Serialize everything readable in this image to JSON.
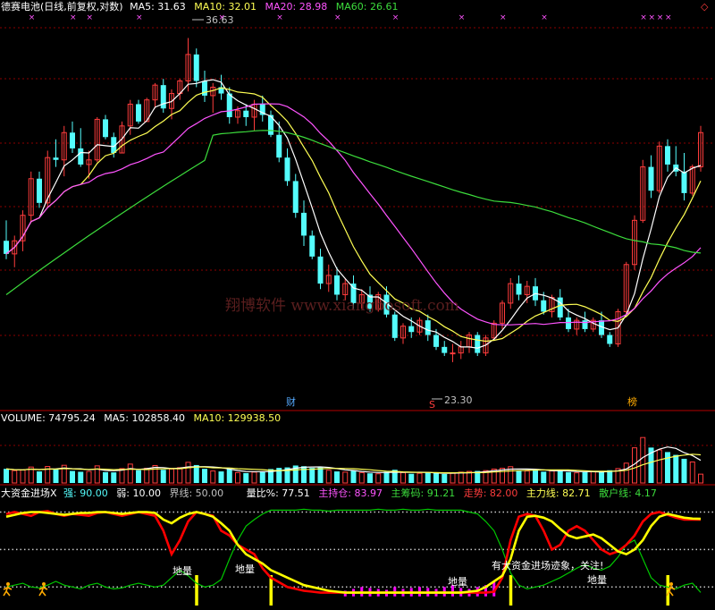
{
  "colors": {
    "up": "#ff3c3c",
    "down": "#54fcfc",
    "ma5": "#ffffff",
    "ma10": "#ffff54",
    "ma20": "#ff54ff",
    "ma60": "#3cdc3c",
    "grid": "#8c0000",
    "dots": "#c8c8c8",
    "red_line": "#ff0000",
    "yellow_line": "#ffff00",
    "green_line": "#00c800",
    "magenta_bar": "#ff00ff",
    "cyan_text": "#54fcfc",
    "white_text": "#ffffff",
    "gray_text": "#c0c0c0"
  },
  "header": {
    "title": "德赛电池(日线,前复权,对数)",
    "ma5": "MA5: 31.63",
    "ma10": "MA10: 32.01",
    "ma20": "MA20: 28.98",
    "ma60": "MA60: 26.61",
    "diamond": "◇"
  },
  "price_annotations": {
    "high": "36.63",
    "low": "23.30",
    "cai": "财",
    "s": "S",
    "bang": "榜",
    "watermark": "翔博软件 www.xiangbosoft.com"
  },
  "volume_header": {
    "volume": "VOLUME: 74795.24",
    "ma5": "MA5: 102858.40",
    "ma10": "MA10: 129938.50"
  },
  "indicator_header": {
    "name": "大资金进场X",
    "strong": "强: 90.00",
    "weak": "弱: 10.00",
    "boundary": "界线: 50.00",
    "volume_ratio": "量比%: 77.51",
    "main_hold": "主持仓: 83.97",
    "main_chip": "主筹码: 91.21",
    "trend": "走势: 82.00",
    "main_line": "主力线: 82.71",
    "retail_line": "散户线: 4.17"
  },
  "indicator_annotations": {
    "label1": "地量",
    "label2": "地量",
    "label3": "地量",
    "label4": "地量",
    "capital_text": "有大资金进场迹象，关注!"
  },
  "chart_data": [
    {
      "type": "candlestick",
      "title": "德赛电池(日线,前复权,对数)",
      "y_scale": "log",
      "ylim": [
        22.3,
        37.3
      ],
      "ohlc": [
        [
          27.6,
          28.4,
          26.9,
          27.1
        ],
        [
          27.1,
          27.8,
          26.6,
          27.6
        ],
        [
          27.6,
          28.8,
          27.2,
          28.6
        ],
        [
          28.6,
          30.4,
          28.3,
          30.1
        ],
        [
          30.1,
          30.4,
          28.9,
          29.1
        ],
        [
          29.1,
          31.3,
          28.9,
          31.0
        ],
        [
          31.0,
          31.8,
          30.6,
          30.9
        ],
        [
          30.9,
          32.4,
          30.2,
          32.1
        ],
        [
          32.1,
          32.6,
          31.2,
          31.4
        ],
        [
          31.4,
          32.3,
          30.6,
          30.7
        ],
        [
          30.7,
          31.3,
          30.1,
          30.9
        ],
        [
          30.9,
          32.8,
          30.8,
          32.7
        ],
        [
          32.7,
          32.9,
          31.8,
          31.9
        ],
        [
          31.9,
          32.1,
          31.0,
          31.2
        ],
        [
          31.2,
          32.6,
          31.2,
          32.4
        ],
        [
          32.4,
          33.6,
          32.0,
          33.4
        ],
        [
          33.4,
          33.6,
          32.5,
          32.6
        ],
        [
          32.6,
          33.7,
          32.6,
          33.6
        ],
        [
          33.6,
          34.4,
          33.2,
          34.3
        ],
        [
          34.3,
          34.6,
          33.0,
          33.2
        ],
        [
          33.2,
          34.1,
          32.7,
          33.9
        ],
        [
          33.9,
          34.6,
          33.6,
          34.5
        ],
        [
          34.5,
          36.63,
          34.0,
          35.8
        ],
        [
          35.8,
          36.1,
          34.2,
          34.5
        ],
        [
          34.5,
          35.0,
          33.5,
          33.8
        ],
        [
          33.8,
          34.4,
          33.0,
          34.2
        ],
        [
          34.2,
          34.8,
          33.6,
          33.9
        ],
        [
          33.9,
          34.2,
          32.5,
          32.8
        ],
        [
          32.8,
          33.3,
          32.5,
          33.1
        ],
        [
          33.1,
          33.4,
          32.4,
          32.8
        ],
        [
          32.8,
          33.6,
          32.2,
          33.4
        ],
        [
          33.4,
          33.8,
          32.6,
          32.9
        ],
        [
          32.9,
          33.1,
          31.9,
          32.0
        ],
        [
          32.0,
          32.6,
          30.8,
          31.0
        ],
        [
          31.0,
          31.4,
          29.8,
          30.0
        ],
        [
          30.0,
          30.3,
          28.5,
          28.7
        ],
        [
          28.7,
          29.2,
          27.4,
          27.8
        ],
        [
          27.8,
          28.0,
          26.9,
          27.0
        ],
        [
          27.0,
          27.3,
          25.8,
          26.0
        ],
        [
          26.0,
          26.7,
          25.7,
          26.3
        ],
        [
          26.3,
          26.6,
          25.4,
          25.6
        ],
        [
          25.6,
          26.2,
          25.4,
          26.0
        ],
        [
          26.0,
          26.3,
          25.1,
          25.3
        ],
        [
          25.3,
          25.8,
          25.1,
          25.6
        ],
        [
          25.6,
          25.9,
          25.0,
          25.1
        ],
        [
          25.1,
          25.7,
          25.0,
          25.6
        ],
        [
          25.6,
          25.9,
          24.8,
          24.9
        ],
        [
          24.9,
          25.0,
          24.0,
          24.1
        ],
        [
          24.1,
          24.6,
          23.9,
          24.5
        ],
        [
          24.5,
          24.8,
          24.1,
          24.3
        ],
        [
          24.3,
          24.8,
          24.2,
          24.7
        ],
        [
          24.7,
          24.9,
          24.0,
          24.2
        ],
        [
          24.2,
          24.4,
          23.7,
          23.8
        ],
        [
          23.8,
          24.0,
          23.5,
          23.6
        ],
        [
          23.6,
          23.9,
          23.3,
          23.6
        ],
        [
          23.6,
          24.0,
          23.4,
          23.8
        ],
        [
          23.8,
          24.3,
          23.6,
          24.2
        ],
        [
          24.2,
          24.3,
          23.5,
          23.6
        ],
        [
          23.6,
          24.2,
          23.5,
          24.1
        ],
        [
          24.1,
          24.7,
          24.0,
          24.6
        ],
        [
          24.6,
          25.4,
          24.4,
          25.3
        ],
        [
          25.3,
          26.2,
          25.1,
          26.0
        ],
        [
          26.0,
          26.3,
          25.4,
          25.6
        ],
        [
          25.6,
          26.1,
          25.3,
          25.9
        ],
        [
          25.9,
          26.2,
          25.2,
          25.4
        ],
        [
          25.4,
          25.7,
          24.9,
          25.0
        ],
        [
          25.0,
          25.6,
          24.8,
          25.5
        ],
        [
          25.5,
          25.8,
          24.7,
          24.8
        ],
        [
          24.8,
          25.1,
          24.3,
          24.4
        ],
        [
          24.4,
          24.8,
          24.2,
          24.7
        ],
        [
          24.7,
          25.0,
          24.3,
          24.4
        ],
        [
          24.4,
          24.8,
          24.3,
          24.7
        ],
        [
          24.7,
          25.0,
          24.1,
          24.2
        ],
        [
          24.2,
          24.3,
          23.8,
          23.9
        ],
        [
          23.9,
          25.1,
          23.8,
          25.0
        ],
        [
          25.0,
          26.8,
          24.9,
          26.7
        ],
        [
          26.7,
          28.6,
          26.5,
          28.4
        ],
        [
          28.4,
          30.9,
          28.3,
          30.6
        ],
        [
          30.6,
          31.1,
          29.3,
          29.6
        ],
        [
          29.6,
          31.7,
          29.5,
          31.5
        ],
        [
          31.5,
          31.8,
          30.4,
          30.7
        ],
        [
          30.7,
          31.5,
          30.2,
          30.4
        ],
        [
          30.4,
          31.2,
          29.2,
          29.5
        ],
        [
          29.5,
          30.7,
          29.4,
          30.6
        ],
        [
          30.6,
          32.4,
          30.4,
          32.1
        ]
      ],
      "ma5_last": 31.63,
      "ma10_last": 32.01,
      "ma20_last": 28.98,
      "ma60_last": 26.61
    },
    {
      "type": "bar",
      "title": "VOLUME",
      "ylim": [
        0,
        500000
      ],
      "values": [
        120000,
        105000,
        110000,
        135000,
        98000,
        140000,
        115000,
        150000,
        102000,
        95000,
        98000,
        145000,
        92000,
        90000,
        122000,
        160000,
        108000,
        125000,
        148000,
        112000,
        118000,
        130000,
        175000,
        152000,
        120000,
        102000,
        98000,
        118000,
        88000,
        84000,
        92000,
        98000,
        118000,
        128000,
        132000,
        148000,
        142000,
        128000,
        132000,
        108000,
        98000,
        92000,
        102000,
        88000,
        82000,
        78000,
        95000,
        112000,
        88000,
        78000,
        82000,
        90000,
        85000,
        76000,
        82000,
        92000,
        98000,
        102000,
        105000,
        118000,
        125000,
        138000,
        108000,
        102000,
        112000,
        96000,
        102000,
        110000,
        92000,
        86000,
        92000,
        96000,
        102000,
        108000,
        122000,
        168000,
        298000,
        385000,
        300000,
        280000,
        262000,
        238000,
        205000,
        178000,
        74795.24
      ],
      "ma5_last": 102858.4,
      "ma10_last": 129938.5
    },
    {
      "type": "line",
      "title": "大资金进场X",
      "ylim": [
        -5,
        100
      ],
      "strong": 90,
      "weak": 10,
      "boundary": 50,
      "series": [
        {
          "name": "走势",
          "values": [
            88,
            90,
            88,
            86,
            90,
            91,
            88,
            86,
            88,
            87,
            86,
            89,
            90,
            88,
            86,
            88,
            90,
            88,
            86,
            70,
            45,
            60,
            80,
            90,
            88,
            86,
            70,
            65,
            55,
            50,
            45,
            30,
            20,
            15,
            10,
            8,
            6,
            5,
            4,
            4,
            4,
            4,
            4,
            4,
            4,
            4,
            4,
            4,
            4,
            4,
            4,
            4,
            4,
            4,
            4,
            4,
            4,
            4,
            4,
            5,
            20,
            60,
            85,
            88,
            86,
            70,
            50,
            55,
            70,
            75,
            70,
            60,
            50,
            45,
            48,
            55,
            65,
            80,
            88,
            90,
            87,
            84,
            82,
            82,
            82
          ]
        },
        {
          "name": "主力线",
          "values": [
            85,
            87,
            89,
            90,
            90,
            89,
            88,
            87,
            88,
            89,
            89,
            90,
            90,
            89,
            88,
            89,
            90,
            90,
            89,
            82,
            78,
            84,
            88,
            90,
            88,
            85,
            78,
            70,
            55,
            45,
            40,
            35,
            28,
            24,
            20,
            16,
            12,
            10,
            8,
            6,
            5,
            4,
            4,
            4,
            4,
            4,
            4,
            4,
            4,
            4,
            4,
            4,
            4,
            4,
            4,
            4,
            5,
            6,
            10,
            16,
            22,
            40,
            70,
            85,
            86,
            84,
            80,
            72,
            65,
            62,
            64,
            66,
            62,
            55,
            48,
            45,
            50,
            60,
            75,
            85,
            88,
            86,
            84,
            83,
            82.71
          ]
        },
        {
          "name": "散户线",
          "values": [
            10,
            12,
            14,
            10,
            9,
            12,
            16,
            12,
            10,
            8,
            12,
            14,
            10,
            8,
            9,
            12,
            14,
            12,
            10,
            12,
            20,
            28,
            22,
            14,
            10,
            12,
            18,
            40,
            60,
            75,
            82,
            88,
            92,
            92,
            92,
            92,
            93,
            92,
            92,
            91,
            92,
            92,
            92,
            92,
            92,
            93,
            92,
            92,
            93,
            92,
            92,
            93,
            92,
            92,
            92,
            92,
            90,
            88,
            80,
            70,
            50,
            25,
            12,
            8,
            10,
            12,
            16,
            20,
            25,
            30,
            34,
            30,
            28,
            32,
            42,
            55,
            60,
            40,
            20,
            12,
            10,
            8,
            12,
            14,
            4.17
          ]
        },
        {
          "name": "量比%",
          "values": [
            0,
            0,
            0,
            0,
            0,
            0,
            0,
            0,
            0,
            0,
            0,
            0,
            0,
            0,
            0,
            0,
            0,
            0,
            0,
            0,
            0,
            0,
            0,
            0,
            0,
            0,
            0,
            0,
            0,
            0,
            0,
            0,
            0,
            0,
            0,
            0,
            0,
            0,
            0,
            0,
            0,
            6,
            8,
            10,
            9,
            8,
            7,
            10,
            8,
            9,
            10,
            9,
            8,
            10,
            12,
            9,
            8,
            10,
            12,
            15,
            0,
            0,
            0,
            0,
            0,
            0,
            0,
            0,
            0,
            0,
            0,
            0,
            0,
            0,
            0,
            0,
            0,
            0,
            0,
            0,
            0,
            0,
            0,
            0,
            0
          ]
        }
      ],
      "markers": [
        23,
        32,
        61,
        80
      ]
    }
  ]
}
